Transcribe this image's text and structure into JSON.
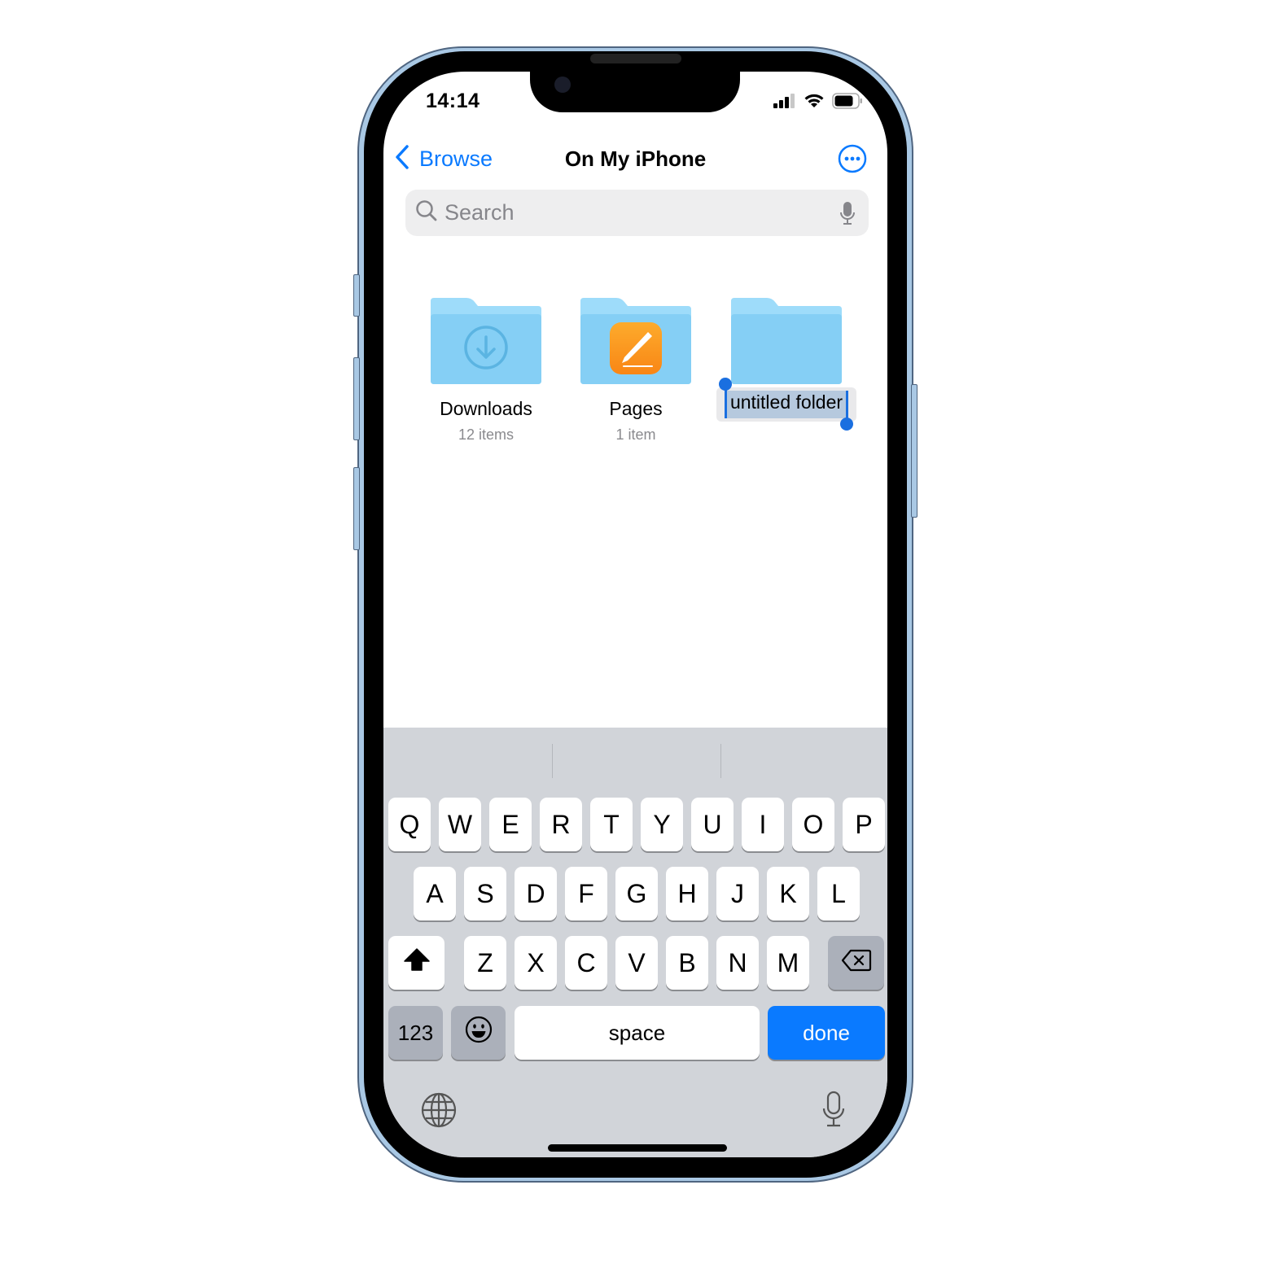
{
  "status_bar": {
    "time": "14:14",
    "icons": [
      "cellular-signal-icon",
      "wifi-icon",
      "battery-icon"
    ]
  },
  "nav": {
    "back_label": "Browse",
    "title": "On My iPhone",
    "more_icon": "ellipsis-circle-icon"
  },
  "search": {
    "placeholder": "Search",
    "value": ""
  },
  "folders": [
    {
      "name": "Downloads",
      "count": "12 items",
      "badge_icon": "download-arrow-icon"
    },
    {
      "name": "Pages",
      "count": "1 item",
      "badge_icon": "pages-app-icon"
    },
    {
      "name": "untitled folder",
      "count": "",
      "editing": true,
      "selected_text": "untitled folder"
    }
  ],
  "colors": {
    "accent": "#0a7aff",
    "folder": "#88d0f6",
    "keyboard_bg": "#d1d4d9",
    "selection": "#b6c9de",
    "phone_frame": "#a9c8e4"
  },
  "keyboard": {
    "row1": [
      "Q",
      "W",
      "E",
      "R",
      "T",
      "Y",
      "U",
      "I",
      "O",
      "P"
    ],
    "row2": [
      "A",
      "S",
      "D",
      "F",
      "G",
      "H",
      "J",
      "K",
      "L"
    ],
    "row3": [
      "Z",
      "X",
      "C",
      "V",
      "B",
      "N",
      "M"
    ],
    "shift_icon": "shift-arrow-icon",
    "delete_icon": "delete-backspace-icon",
    "numbers_label": "123",
    "emoji_icon": "emoji-face-icon",
    "space_label": "space",
    "done_label": "done",
    "globe_icon": "globe-icon",
    "dictation_icon": "microphone-icon"
  }
}
